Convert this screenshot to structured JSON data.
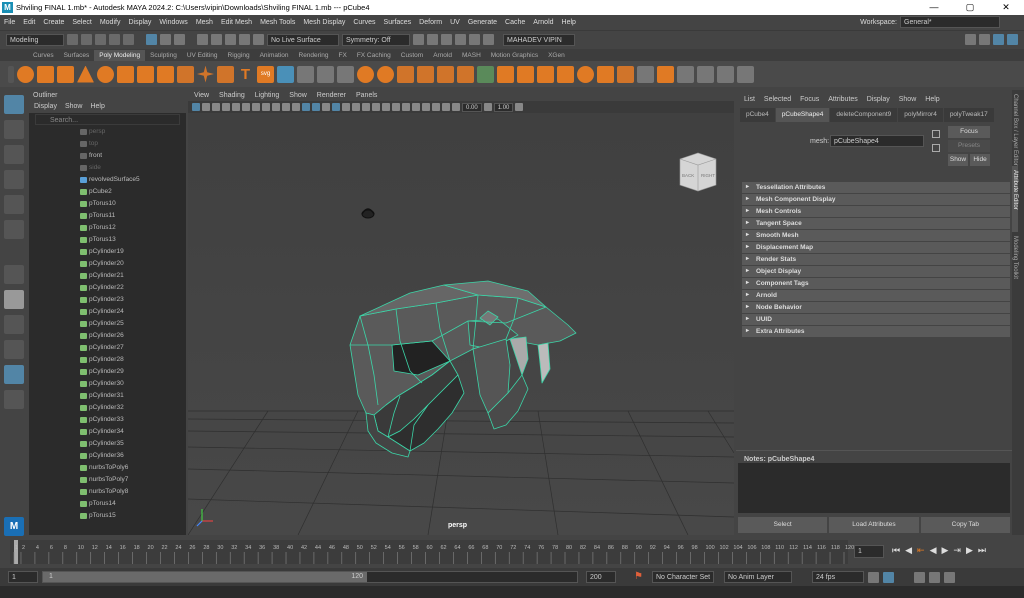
{
  "window": {
    "title": "Shviling FINAL 1.mb* - Autodesk MAYA 2024.2: C:\\Users\\vipin\\Downloads\\Shviling FINAL 1.mb   ---   pCube4",
    "logo": "M",
    "controls": [
      "—",
      "▢",
      "✕"
    ]
  },
  "menubar": [
    "File",
    "Edit",
    "Create",
    "Select",
    "Modify",
    "Display",
    "Windows",
    "Mesh",
    "Edit Mesh",
    "Mesh Tools",
    "Mesh Display",
    "Curves",
    "Surfaces",
    "Deform",
    "UV",
    "Generate",
    "Cache",
    "Arnold",
    "Help"
  ],
  "workspace": {
    "label": "Workspace:",
    "value": "General*"
  },
  "statusline": {
    "menuset": "Modeling",
    "live_surface": "No Live Surface",
    "symmetry": "Symmetry: Off",
    "user": "MAHADEV VIPIN"
  },
  "shelf_tabs": [
    "Curves",
    "Surfaces",
    "Poly Modeling",
    "Sculpting",
    "UV Editing",
    "Rigging",
    "Animation",
    "Rendering",
    "FX",
    "FX Caching",
    "Custom",
    "Arnold",
    "MASH",
    "Motion Graphics",
    "XGen"
  ],
  "shelf_active": "Poly Modeling",
  "shelf_text_icons": {
    "text": "T",
    "svg": "svg"
  },
  "outliner": {
    "title": "Outliner",
    "menu": [
      "Display",
      "Show",
      "Help"
    ],
    "search_placeholder": "Search...",
    "items": [
      "persp",
      "top",
      "front",
      "side",
      "revolvedSurface5",
      "pCube2",
      "pTorus10",
      "pTorus11",
      "pTorus12",
      "pTorus13",
      "pCylinder19",
      "pCylinder20",
      "pCylinder21",
      "pCylinder22",
      "pCylinder23",
      "pCylinder24",
      "pCylinder25",
      "pCylinder26",
      "pCylinder27",
      "pCylinder28",
      "pCylinder29",
      "pCylinder30",
      "pCylinder31",
      "pCylinder32",
      "pCylinder33",
      "pCylinder34",
      "pCylinder35",
      "pCylinder36",
      "nurbsToPoly6",
      "nurbsToPoly7",
      "nurbsToPoly8",
      "pTorus14",
      "pTorus15"
    ],
    "dim_items": [
      "persp",
      "top",
      "side"
    ]
  },
  "viewport": {
    "menu": [
      "View",
      "Shading",
      "Lighting",
      "Show",
      "Renderer",
      "Panels"
    ],
    "camera_label": "persp",
    "viewcube": {
      "back": "BACK",
      "right": "RIGHT"
    },
    "field1": "0.00",
    "field2": "1.00",
    "gamma": "0.0"
  },
  "attribute_editor": {
    "menu": [
      "List",
      "Selected",
      "Focus",
      "Attributes",
      "Display",
      "Show",
      "Help"
    ],
    "tabs": [
      "pCube4",
      "pCubeShape4",
      "deleteComponent9",
      "polyMirror4",
      "polyTweak17"
    ],
    "active_tab": "pCubeShape4",
    "mesh_label": "mesh:",
    "mesh_value": "pCubeShape4",
    "buttons": {
      "focus": "Focus",
      "presets": "Presets",
      "show": "Show",
      "hide": "Hide"
    },
    "sections": [
      "Tessellation Attributes",
      "Mesh Component Display",
      "Mesh Controls",
      "Tangent Space",
      "Smooth Mesh",
      "Displacement Map",
      "Render Stats",
      "Object Display",
      "Component Tags",
      "Arnold",
      "Node Behavior",
      "UUID",
      "Extra Attributes"
    ],
    "notes_label": "Notes: pCubeShape4",
    "bottom_buttons": [
      "Select",
      "Load Attributes",
      "Copy Tab"
    ]
  },
  "side_strip": [
    "Channel Box / Layer Editor",
    "Attribute Editor",
    "Modeling Toolkit"
  ],
  "timeline": {
    "ticks": [
      1,
      2,
      4,
      6,
      8,
      10,
      12,
      14,
      16,
      18,
      20,
      22,
      24,
      26,
      28,
      30,
      32,
      34,
      36,
      38,
      40,
      42,
      44,
      46,
      48,
      50,
      52,
      54,
      56,
      58,
      60,
      62,
      64,
      66,
      68,
      70,
      72,
      74,
      76,
      78,
      80,
      82,
      84,
      86,
      88,
      90,
      92,
      94,
      96,
      98,
      100,
      102,
      104,
      106,
      108,
      110,
      112,
      114,
      116,
      118,
      120
    ],
    "current_frame": "1"
  },
  "range": {
    "start": "1",
    "slider_start": "1",
    "slider_end": "120",
    "end": "200",
    "char_set": "No Character Set",
    "anim_layer": "No Anim Layer",
    "fps": "24 fps"
  },
  "colors": {
    "accent": "#5285a6",
    "wire": "#3cd6a8",
    "bg": "#444444"
  }
}
